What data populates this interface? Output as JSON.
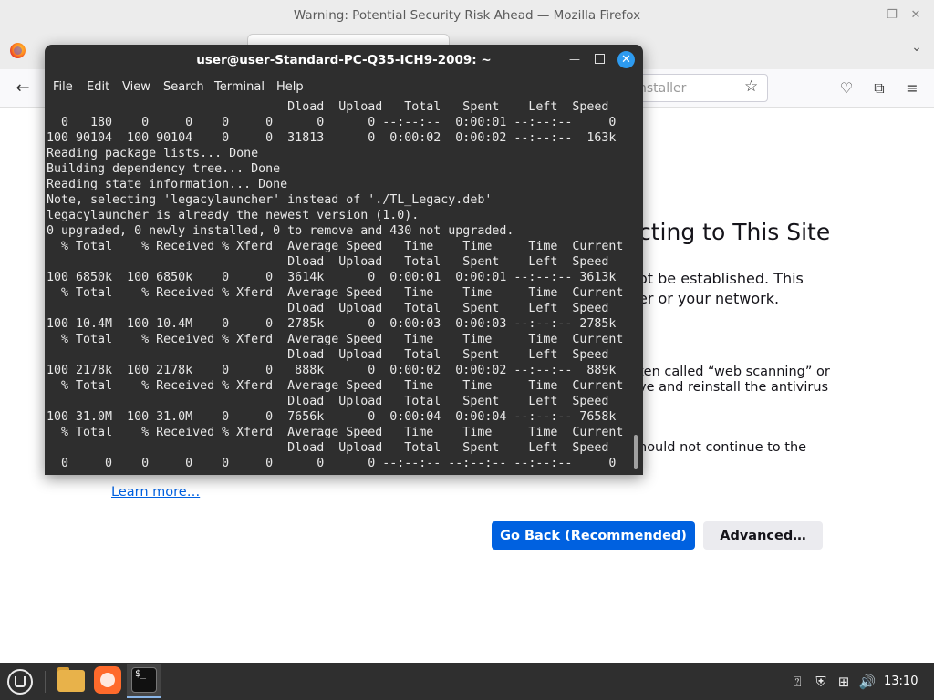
{
  "firefox": {
    "window_title": "Warning: Potential Security Risk Ahead — Mozilla Firefox",
    "url_fragment": "nstaller",
    "tabs_menu_icon": "chevron-down-icon"
  },
  "error_page": {
    "title_fragment": "cting to This Site",
    "line1": "ot be established. This",
    "line2": "er or your network.",
    "line3": "ten called “web scanning” or",
    "line4": "ve and reinstall the antivirus",
    "line5": "hould not continue to the",
    "learn_more": "Learn more…",
    "go_back": "Go Back (Recommended)",
    "advanced": "Advanced…"
  },
  "terminal": {
    "title": "user@user-Standard-PC-Q35-ICH9-2009: ~",
    "menu": [
      "File",
      "Edit",
      "View",
      "Search",
      "Terminal",
      "Help"
    ],
    "lines": [
      "                                 Dload  Upload   Total   Spent    Left  Speed",
      "  0   180    0     0    0     0      0      0 --:--:--  0:00:01 --:--:--     0",
      "100 90104  100 90104    0     0  31813      0  0:00:02  0:00:02 --:--:--  163k",
      "Reading package lists... Done",
      "Building dependency tree... Done",
      "Reading state information... Done",
      "Note, selecting 'legacylauncher' instead of './TL_Legacy.deb'",
      "legacylauncher is already the newest version (1.0).",
      "0 upgraded, 0 newly installed, 0 to remove and 430 not upgraded.",
      "  % Total    % Received % Xferd  Average Speed   Time    Time     Time  Current",
      "                                 Dload  Upload   Total   Spent    Left  Speed",
      "100 6850k  100 6850k    0     0  3614k      0  0:00:01  0:00:01 --:--:-- 3613k",
      "  % Total    % Received % Xferd  Average Speed   Time    Time     Time  Current",
      "                                 Dload  Upload   Total   Spent    Left  Speed",
      "100 10.4M  100 10.4M    0     0  2785k      0  0:00:03  0:00:03 --:--:-- 2785k",
      "  % Total    % Received % Xferd  Average Speed   Time    Time     Time  Current",
      "                                 Dload  Upload   Total   Spent    Left  Speed",
      "100 2178k  100 2178k    0     0   888k      0  0:00:02  0:00:02 --:--:--  889k",
      "  % Total    % Received % Xferd  Average Speed   Time    Time     Time  Current",
      "                                 Dload  Upload   Total   Spent    Left  Speed",
      "100 31.0M  100 31.0M    0     0  7656k      0  0:00:04  0:00:04 --:--:-- 7658k",
      "  % Total    % Received % Xferd  Average Speed   Time    Time     Time  Current",
      "                                 Dload  Upload   Total   Spent    Left  Speed",
      "  0     0    0     0    0     0      0      0 --:--:-- --:--:-- --:--:--     0"
    ]
  },
  "taskbar": {
    "clock": "13:10",
    "apps": [
      "files-icon",
      "firefox-icon",
      "terminal-icon"
    ],
    "terminal_glyph": "$_"
  }
}
